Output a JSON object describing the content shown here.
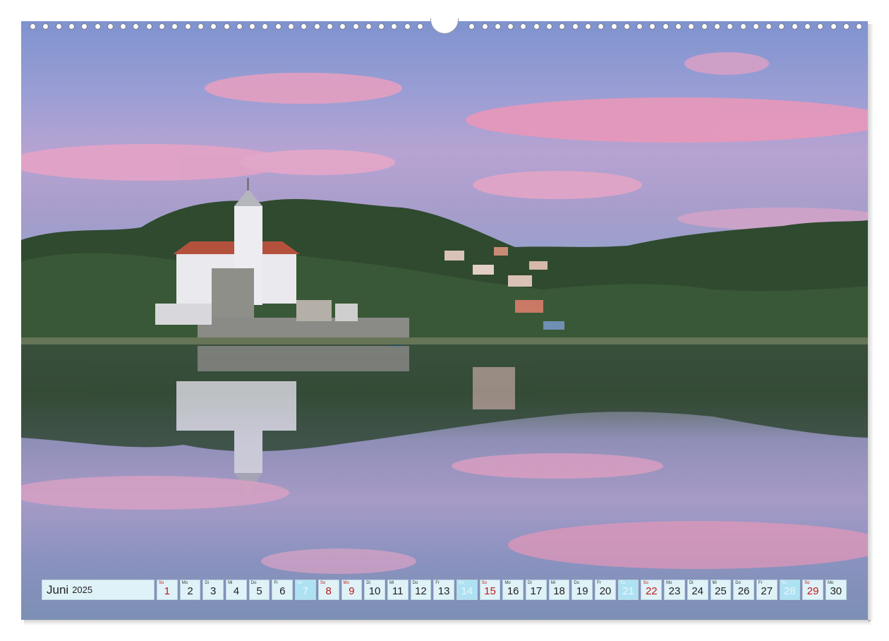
{
  "colors": {
    "calendar_cell": "#dff2f8",
    "saturday_cell": "#aee2f2",
    "sunday_text": "#c21818"
  },
  "calendar": {
    "month": "Juni",
    "year": "2025",
    "days": [
      {
        "wd": "So",
        "d": "1",
        "type": "sun"
      },
      {
        "wd": "Mo",
        "d": "2",
        "type": "normal"
      },
      {
        "wd": "Di",
        "d": "3",
        "type": "normal"
      },
      {
        "wd": "Mi",
        "d": "4",
        "type": "normal"
      },
      {
        "wd": "Do",
        "d": "5",
        "type": "normal"
      },
      {
        "wd": "Fr",
        "d": "6",
        "type": "normal"
      },
      {
        "wd": "Sa",
        "d": "7",
        "type": "sat"
      },
      {
        "wd": "So",
        "d": "8",
        "type": "sun"
      },
      {
        "wd": "Mo",
        "d": "9",
        "type": "sun"
      },
      {
        "wd": "Di",
        "d": "10",
        "type": "normal"
      },
      {
        "wd": "Mi",
        "d": "11",
        "type": "normal"
      },
      {
        "wd": "Do",
        "d": "12",
        "type": "normal"
      },
      {
        "wd": "Fr",
        "d": "13",
        "type": "normal"
      },
      {
        "wd": "Sa",
        "d": "14",
        "type": "sat"
      },
      {
        "wd": "So",
        "d": "15",
        "type": "sun"
      },
      {
        "wd": "Mo",
        "d": "16",
        "type": "normal"
      },
      {
        "wd": "Di",
        "d": "17",
        "type": "normal"
      },
      {
        "wd": "Mi",
        "d": "18",
        "type": "normal"
      },
      {
        "wd": "Do",
        "d": "19",
        "type": "normal"
      },
      {
        "wd": "Fr",
        "d": "20",
        "type": "normal"
      },
      {
        "wd": "Sa",
        "d": "21",
        "type": "sat"
      },
      {
        "wd": "So",
        "d": "22",
        "type": "sun"
      },
      {
        "wd": "Mo",
        "d": "23",
        "type": "normal"
      },
      {
        "wd": "Di",
        "d": "24",
        "type": "normal"
      },
      {
        "wd": "Mi",
        "d": "25",
        "type": "normal"
      },
      {
        "wd": "Do",
        "d": "26",
        "type": "normal"
      },
      {
        "wd": "Fr",
        "d": "27",
        "type": "normal"
      },
      {
        "wd": "Sa",
        "d": "28",
        "type": "sat"
      },
      {
        "wd": "So",
        "d": "29",
        "type": "sun"
      },
      {
        "wd": "Mo",
        "d": "30",
        "type": "normal"
      }
    ]
  }
}
